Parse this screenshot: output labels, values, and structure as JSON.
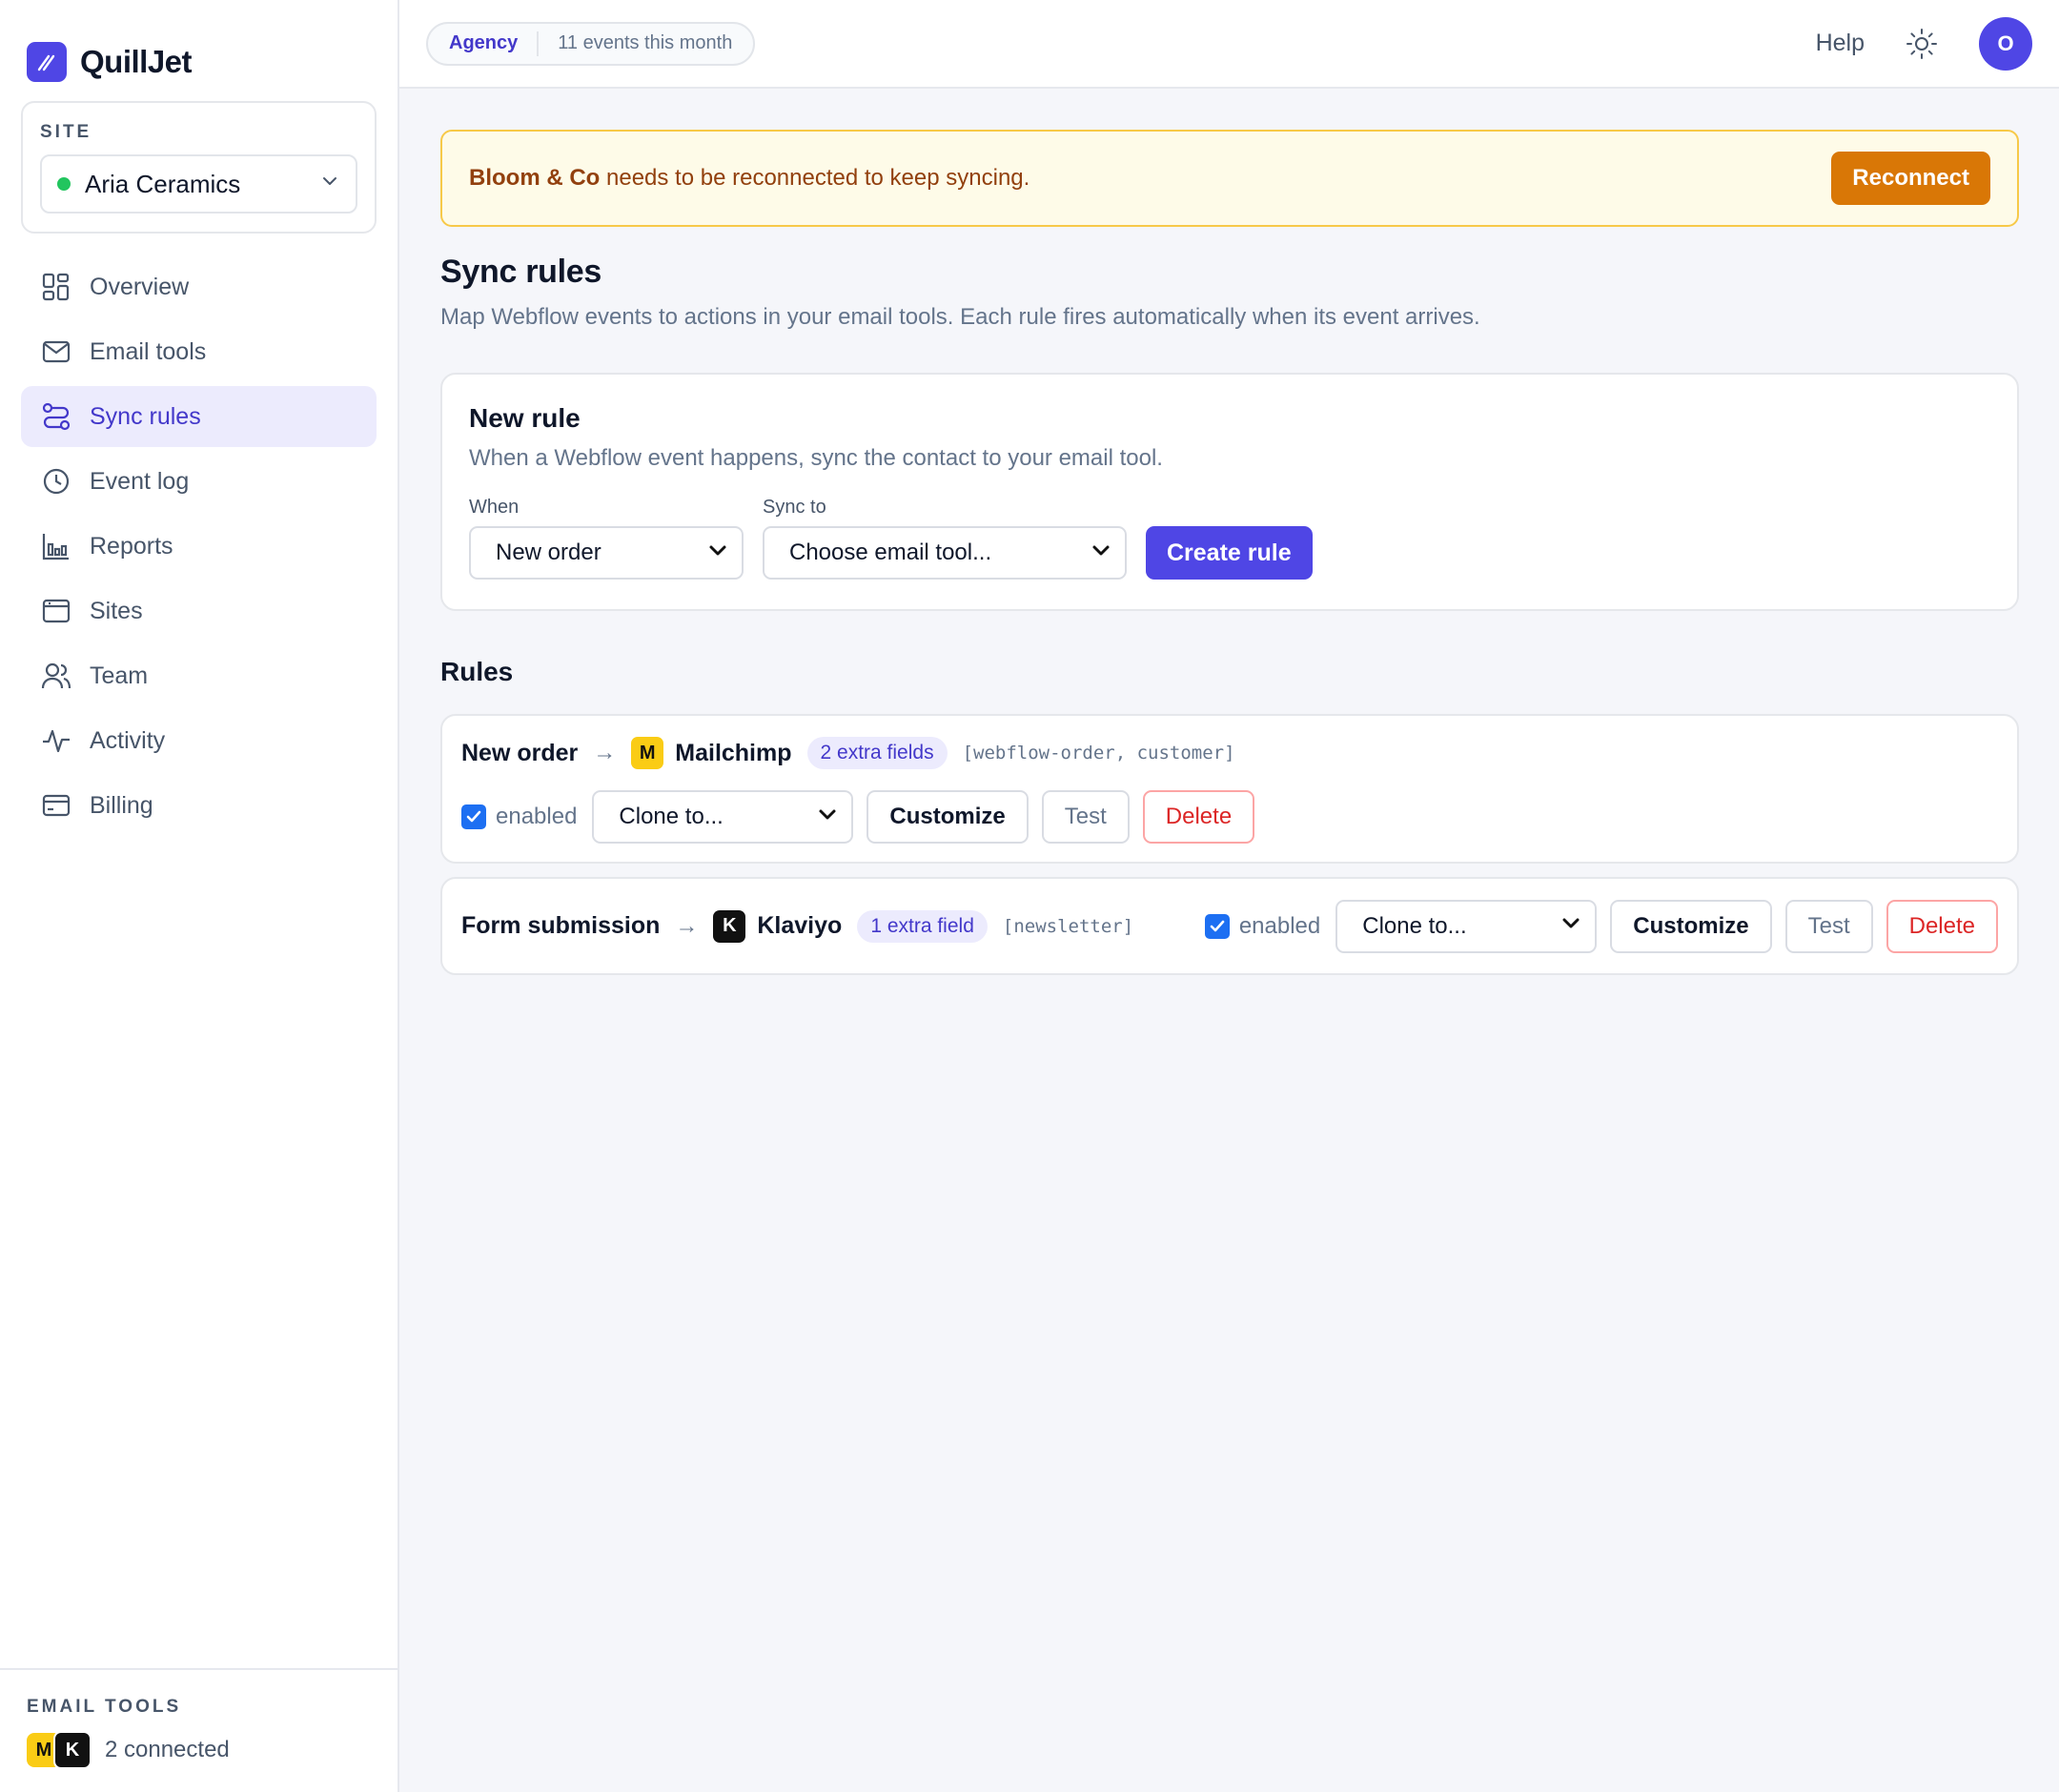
{
  "brand": {
    "name": "QuillJet"
  },
  "site": {
    "label": "SITE",
    "name": "Aria Ceramics",
    "status_color": "#22c55e"
  },
  "nav": {
    "items": [
      {
        "label": "Overview",
        "icon": "grid-icon"
      },
      {
        "label": "Email tools",
        "icon": "mail-icon"
      },
      {
        "label": "Sync rules",
        "icon": "route-icon",
        "active": true
      },
      {
        "label": "Event log",
        "icon": "clock-icon"
      },
      {
        "label": "Reports",
        "icon": "bar-chart-icon"
      },
      {
        "label": "Sites",
        "icon": "browser-icon"
      },
      {
        "label": "Team",
        "icon": "users-icon"
      },
      {
        "label": "Activity",
        "icon": "activity-icon"
      },
      {
        "label": "Billing",
        "icon": "credit-card-icon"
      }
    ]
  },
  "sidebar_footer": {
    "label": "EMAIL TOOLS",
    "badges": [
      "M",
      "K"
    ],
    "count_text": "2 connected"
  },
  "topbar": {
    "plan": "Agency",
    "events": "11 events this month",
    "help": "Help",
    "avatar_initial": "O"
  },
  "banner": {
    "strong": "Bloom & Co",
    "text": " needs to be reconnected to keep syncing.",
    "button": "Reconnect"
  },
  "page": {
    "title": "Sync rules",
    "subtitle": "Map Webflow events to actions in your email tools. Each rule fires automatically when its event arrives."
  },
  "new_rule": {
    "title": "New rule",
    "subtitle": "When a Webflow event happens, sync the contact to your email tool.",
    "when_label": "When",
    "when_value": "New order",
    "sync_label": "Sync to",
    "sync_value": "Choose email tool...",
    "create_button": "Create rule"
  },
  "rules": {
    "title": "Rules",
    "items": [
      {
        "event": "New order",
        "arrow": "→",
        "tool_badge": "M",
        "tool": "Mailchimp",
        "fields": "2 extra fields",
        "tags": "[webflow-order, customer]",
        "enabled_label": "enabled",
        "clone": "Clone to...",
        "customize": "Customize",
        "test": "Test",
        "delete": "Delete"
      },
      {
        "event": "Form submission",
        "arrow": "→",
        "tool_badge": "K",
        "tool": "Klaviyo",
        "fields": "1 extra field",
        "tags": "[newsletter]",
        "enabled_label": "enabled",
        "clone": "Clone to...",
        "customize": "Customize",
        "test": "Test",
        "delete": "Delete"
      }
    ]
  },
  "colors": {
    "accent": "#4f46e5",
    "warning": "#d97706",
    "danger": "#dc2626",
    "checkbox": "#1d6ff2"
  }
}
